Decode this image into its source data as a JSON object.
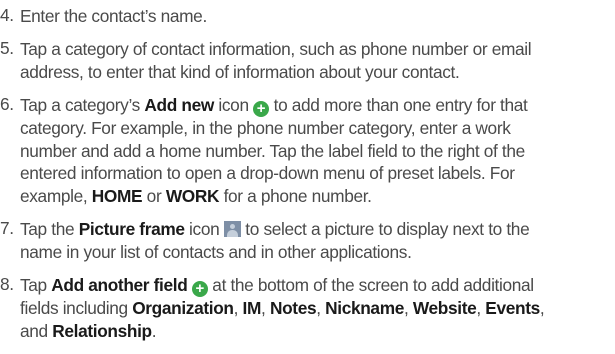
{
  "steps": [
    {
      "num": "4.",
      "lines": [
        "Enter the contact’s name."
      ]
    },
    {
      "num": "5.",
      "lines": [
        "Tap a category of contact information, such as phone number or email",
        "address, to enter that kind of information about your contact."
      ]
    },
    {
      "num": "6.",
      "l1a": "Tap a category’s ",
      "l1b": "Add new",
      "l1c": " icon ",
      "l1d": " to add more than one entry for that",
      "lines": [
        "category. For example, in the phone number category, enter a work",
        "number and add a home number. Tap the label field to the right of the",
        "entered information to open a drop-down menu of preset labels. For"
      ],
      "l5a": "example, ",
      "l5b": "HOME",
      "l5c": " or ",
      "l5d": "WORK",
      "l5e": " for a phone number."
    },
    {
      "num": "7.",
      "l1a": "Tap the ",
      "l1b": "Picture frame",
      "l1c": " icon ",
      "l1d": " to select a picture to display next to the",
      "l2": "name in your list of contacts and in other applications."
    },
    {
      "num": "8.",
      "l1a": "Tap ",
      "l1b": "Add another field",
      "l1c": " ",
      "l1d": " at the bottom of the screen to add additional",
      "l2a": "fields including ",
      "l2b": "Organization",
      "l2c": ", ",
      "l2d": "IM",
      "l2e": ", ",
      "l2f": "Notes",
      "l2g": ", ",
      "l2h": "Nickname",
      "l2i": ", ",
      "l2j": "Website",
      "l2k": ", ",
      "l2l": "Events",
      "l2m": ",",
      "l3a": "and ",
      "l3b": "Relationship",
      "l3c": "."
    }
  ],
  "icons": {
    "add": "add-new-icon",
    "picture": "picture-frame-icon",
    "plus_glyph": "+"
  }
}
